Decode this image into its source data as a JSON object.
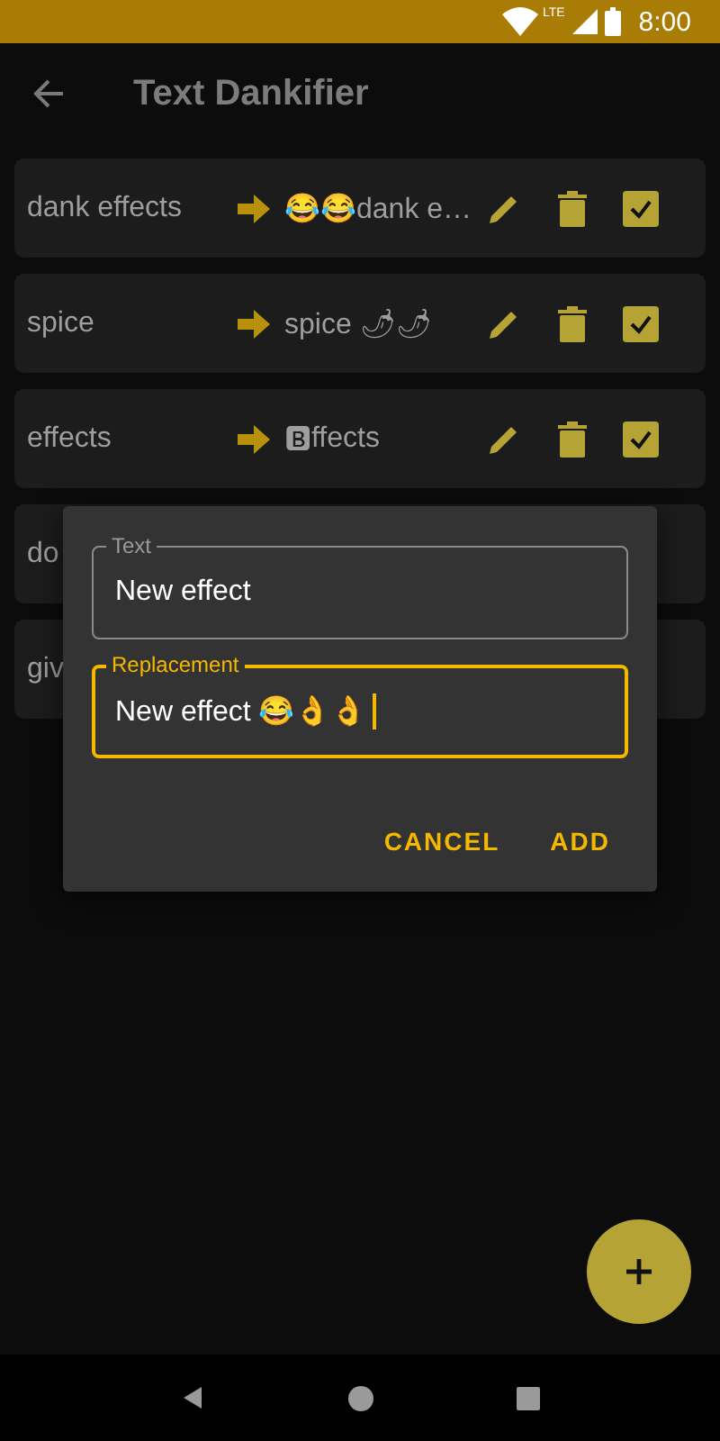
{
  "status_bar": {
    "network": "LTE",
    "time": "8:00"
  },
  "app_bar": {
    "title": "Text Dankifier"
  },
  "rows": [
    {
      "text": "dank effects",
      "replacement": "😂😂dank e…",
      "checked": true
    },
    {
      "text": "spice",
      "replacement": "spice 🌶🌶",
      "checked": true
    },
    {
      "text": "effects",
      "replacement": "🅱ffects",
      "checked": true
    },
    {
      "text": "do"
    },
    {
      "text": "giv"
    }
  ],
  "dialog": {
    "fields": [
      {
        "label": "Text",
        "value": "New effect",
        "focused": false
      },
      {
        "label": "Replacement",
        "value": "New effect 😂👌👌",
        "focused": true
      }
    ],
    "buttons": [
      "CANCEL",
      "ADD"
    ]
  }
}
